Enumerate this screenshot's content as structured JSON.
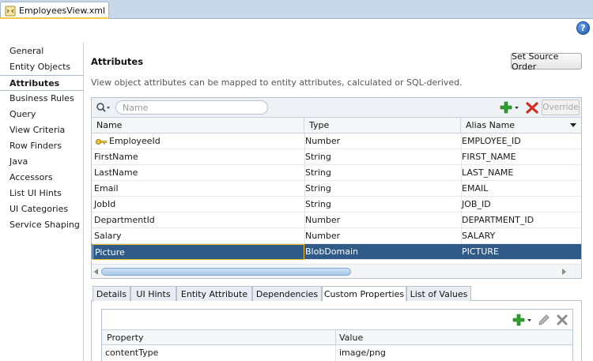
{
  "editor_tab": {
    "label": "EmployeesView.xml"
  },
  "help": {
    "label": "?"
  },
  "nav": {
    "items": [
      {
        "label": "General"
      },
      {
        "label": "Entity Objects"
      },
      {
        "label": "Attributes"
      },
      {
        "label": "Business Rules"
      },
      {
        "label": "Query"
      },
      {
        "label": "View Criteria"
      },
      {
        "label": "Row Finders"
      },
      {
        "label": "Java"
      },
      {
        "label": "Accessors"
      },
      {
        "label": "List UI Hints"
      },
      {
        "label": "UI Categories"
      },
      {
        "label": "Service Shaping"
      }
    ],
    "active": "Attributes"
  },
  "main": {
    "title": "Attributes",
    "description": "View object attributes can be mapped to entity attributes, calculated or SQL-derived.",
    "set_source_order_label": "Set Source Order"
  },
  "attr_toolbar": {
    "search_placeholder": "Name",
    "override_label": "Override"
  },
  "attr_table": {
    "columns": [
      "Name",
      "Type",
      "Alias Name"
    ],
    "rows": [
      {
        "name": "EmployeeId",
        "type": "Number",
        "alias": "EMPLOYEE_ID",
        "icon": "key-icon"
      },
      {
        "name": "FirstName",
        "type": "String",
        "alias": "FIRST_NAME"
      },
      {
        "name": "LastName",
        "type": "String",
        "alias": "LAST_NAME"
      },
      {
        "name": "Email",
        "type": "String",
        "alias": "EMAIL"
      },
      {
        "name": "JobId",
        "type": "String",
        "alias": "JOB_ID"
      },
      {
        "name": "DepartmentId",
        "type": "Number",
        "alias": "DEPARTMENT_ID"
      },
      {
        "name": "Salary",
        "type": "Number",
        "alias": "SALARY"
      },
      {
        "name": "Picture",
        "type": "BlobDomain",
        "alias": "PICTURE",
        "selected": true
      }
    ]
  },
  "detail_tabs": {
    "items": [
      {
        "label": "Details"
      },
      {
        "label": "UI Hints"
      },
      {
        "label": "Entity Attribute"
      },
      {
        "label": "Dependencies"
      },
      {
        "label": "Custom Properties"
      },
      {
        "label": "List of Values"
      }
    ],
    "active": "Custom Properties"
  },
  "custom_props": {
    "columns": [
      "Property",
      "Value"
    ],
    "rows": [
      {
        "property": "contentType",
        "value": "image/png"
      }
    ]
  },
  "colors": {
    "selection": "#305a87",
    "selection_focus": "#f2b81f",
    "tabstrip": "#c9d8e9",
    "add_green": "#2e9e2e",
    "delete_red": "#d52b1e"
  }
}
